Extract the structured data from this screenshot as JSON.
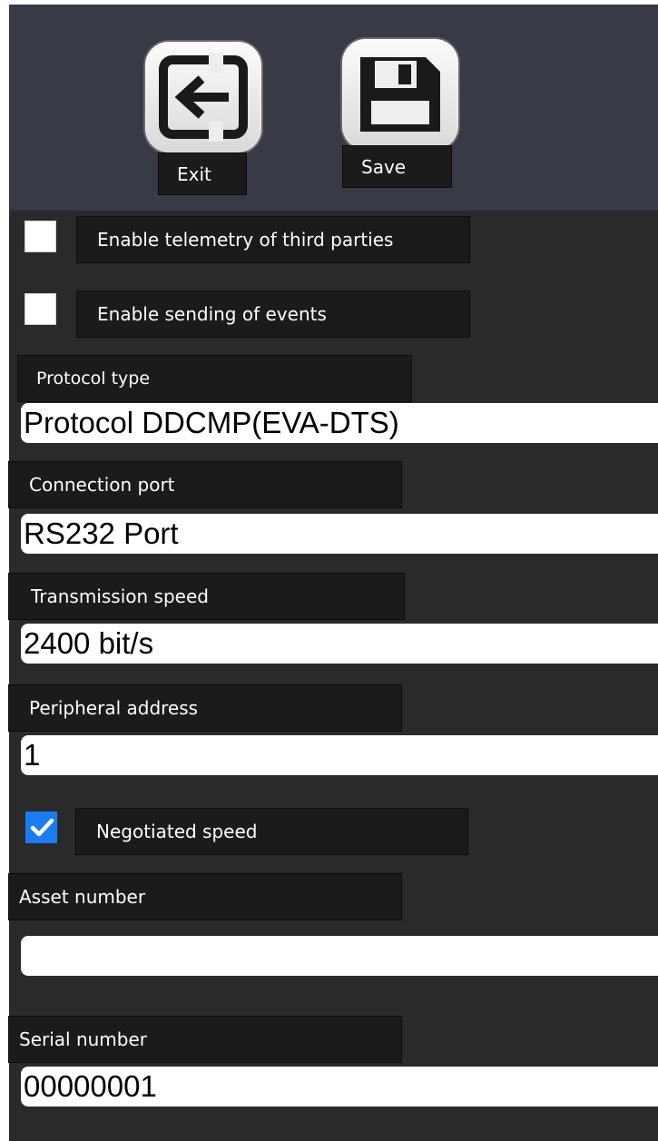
{
  "toolbar": {
    "exit_label": "Exit",
    "save_label": "Save"
  },
  "options": {
    "third_party_telemetry": {
      "label": "Enable telemetry of third parties",
      "checked": false
    },
    "sending_events": {
      "label": "Enable sending of events",
      "checked": false
    },
    "negotiated_speed": {
      "label": "Negotiated speed",
      "checked": true
    }
  },
  "fields": {
    "protocol_type": {
      "label": "Protocol type",
      "value": "Protocol DDCMP(EVA-DTS)"
    },
    "connection_port": {
      "label": "Connection port",
      "value": "RS232 Port"
    },
    "transmission_speed": {
      "label": "Transmission speed",
      "value": "2400 bit/s"
    },
    "peripheral_address": {
      "label": "Peripheral address",
      "value": "1"
    },
    "asset_number": {
      "label": "Asset number",
      "value": ""
    },
    "serial_number": {
      "label": "Serial number",
      "value": "00000001"
    }
  },
  "colors": {
    "toolbar_bg": "#383a46",
    "panel_bg": "#2a2a2a",
    "checkbox_checked": "#1a7cf2"
  }
}
